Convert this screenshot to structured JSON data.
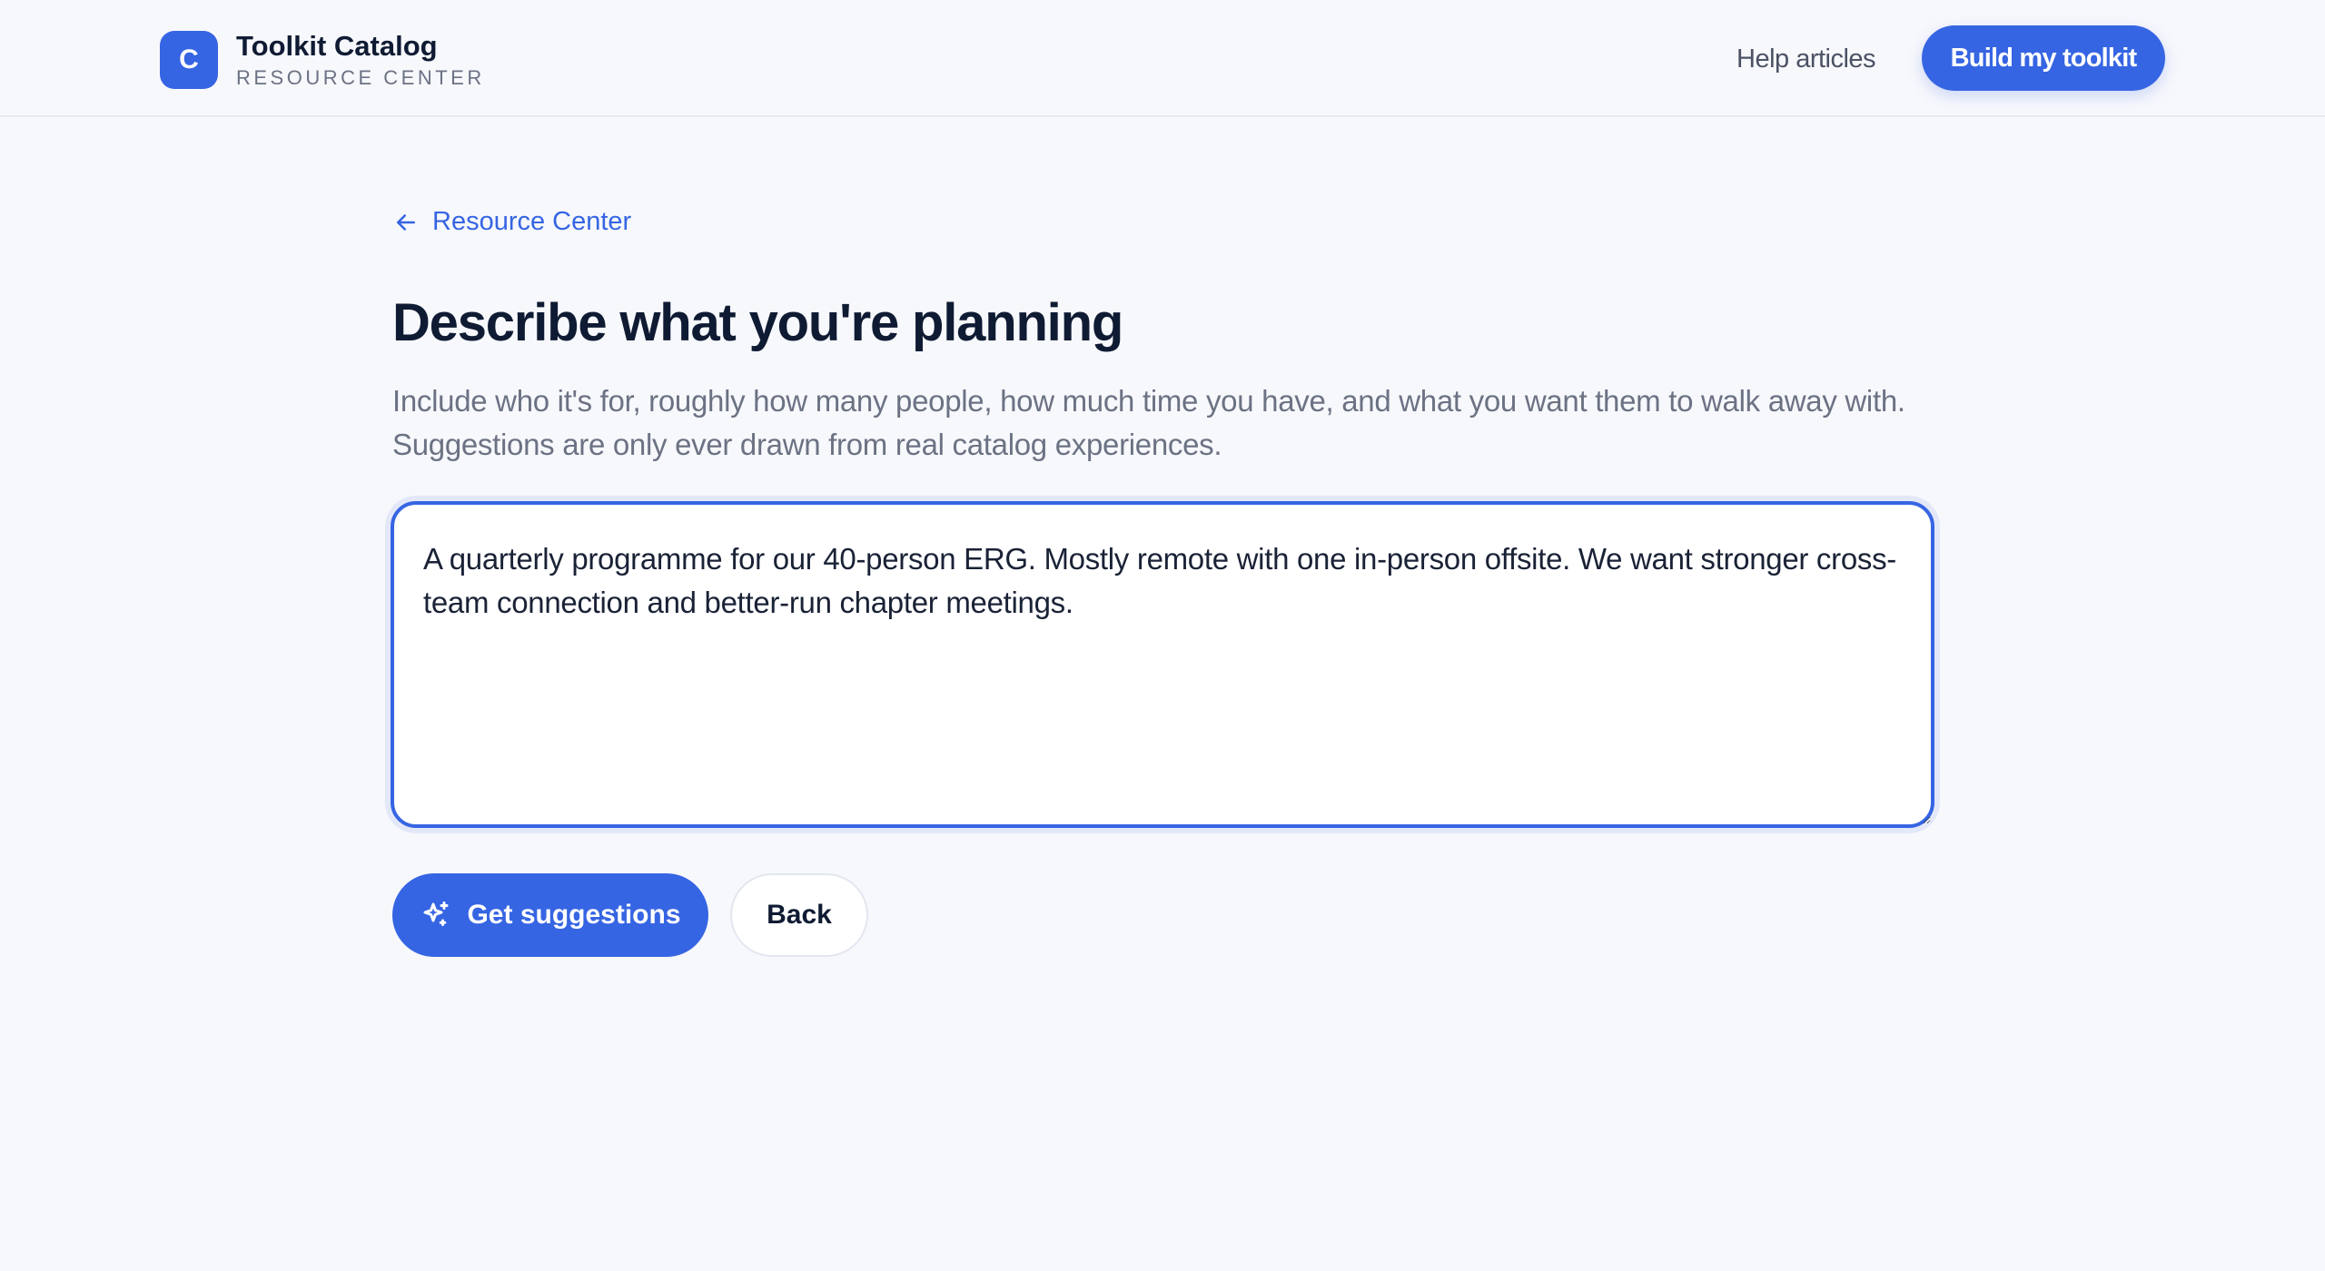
{
  "header": {
    "brand_initial": "C",
    "brand_title": "Toolkit Catalog",
    "brand_subtitle": "RESOURCE CENTER",
    "help_link": "Help articles",
    "build_button": "Build my toolkit"
  },
  "breadcrumb": {
    "icon": "arrow-left-icon",
    "label": "Resource Center"
  },
  "main": {
    "title": "Describe what you're planning",
    "description": "Include who it's for, roughly how many people, how much time you have, and what you want them to walk away with. Suggestions are only ever drawn from real catalog experiences.",
    "plan_input_value": "A quarterly programme for our 40-person ERG. Mostly remote with one in-person offsite. We want stronger cross-team connection and better-run chapter meetings.",
    "suggest_icon": "sparkles-icon",
    "suggest_button": "Get suggestions",
    "back_button": "Back"
  },
  "colors": {
    "accent": "#3665e3",
    "background": "#f7f8fc",
    "heading": "#0f1b33",
    "muted": "#6b7283"
  }
}
